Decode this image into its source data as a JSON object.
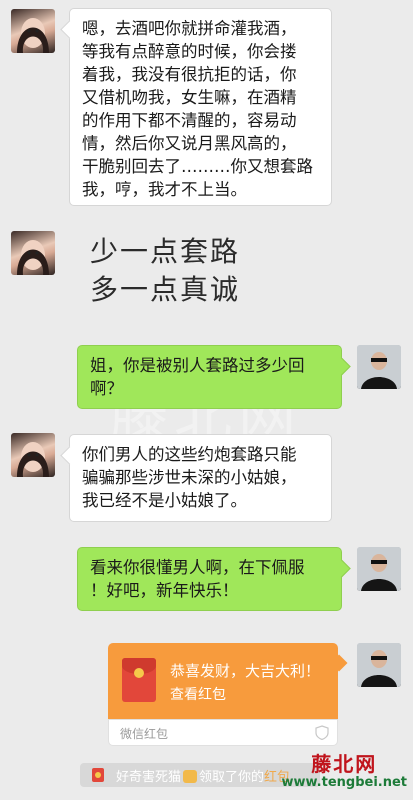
{
  "watermark_bg": "滕北网",
  "messages": [
    {
      "side": "left",
      "lines": [
        "嗯，去酒吧你就拼命灌我酒，",
        "等我有点醉意的时候，你会搂",
        "着我，我没有很抗拒的话，你",
        "又借机吻我，女生嘛，在酒精",
        "的作用下都不清醒的，容易动",
        "情，然后你又说月黑风高的，",
        "干脆别回去了………你又想套路",
        "我，哼，我才不上当。"
      ]
    },
    {
      "side": "left-plain",
      "lines": [
        "少一点套路",
        "多一点真诚"
      ]
    },
    {
      "side": "right",
      "lines": [
        "姐，你是被别人套路过多少回",
        "啊？"
      ]
    },
    {
      "side": "left",
      "lines": [
        "你们男人的这些约炮套路只能",
        "骗骗那些涉世未深的小姑娘，",
        "我已经不是小姑娘了。"
      ]
    },
    {
      "side": "right",
      "lines": [
        "看来你很懂男人啊，在下佩服",
        "！好吧，新年快乐！"
      ]
    }
  ],
  "red_packet": {
    "title": "恭喜发财，大吉大利！",
    "subtitle": "查看红包",
    "label": "微信红包"
  },
  "system_notice": {
    "text_before": "好奇害死猫",
    "text_after": "领取了你的",
    "text_tail": "红包"
  },
  "watermark_logo": {
    "name": "藤北网",
    "url": "www.tengbei.net"
  },
  "colors": {
    "background": "#ebebeb",
    "bubble_left": "#ffffff",
    "bubble_right": "#a0e75a",
    "red_packet": "#f79b3d"
  }
}
